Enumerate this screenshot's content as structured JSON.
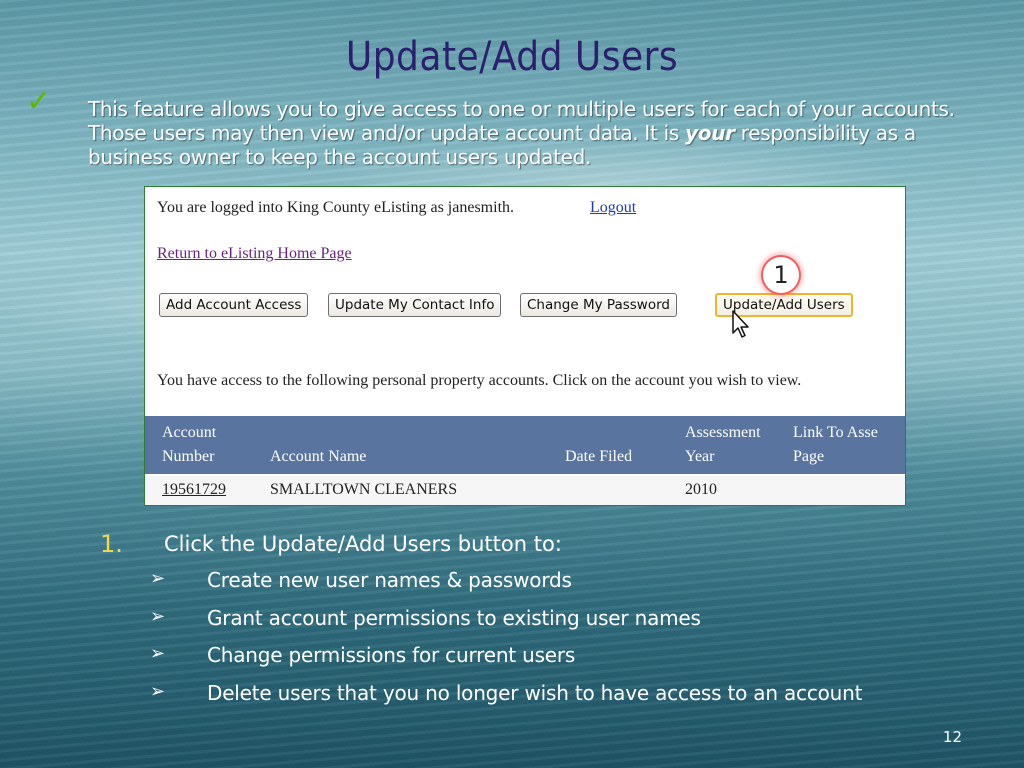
{
  "slide": {
    "title": "Update/Add Users",
    "check_icon": "checkmark-icon",
    "intro_part1": "This feature allows you to give access to one or multiple users for each of your accounts.  Those users may then view and/or update account data.  It is ",
    "intro_emphasis": "your",
    "intro_part2": " responsibility as a business owner to keep the account users updated.",
    "page_number": "12"
  },
  "screenshot": {
    "login_text": "You are logged into King County eListing as janesmith.",
    "logout_label": "Logout",
    "return_link": "Return to eListing Home Page",
    "buttons": {
      "add_account_access": "Add Account Access",
      "update_contact_info": "Update My Contact Info",
      "change_password": "Change My Password",
      "update_add_users": "Update/Add Users"
    },
    "callout_number": "1",
    "access_text": "You have access to the following personal property accounts. Click on the account you wish to view.",
    "table": {
      "headers": {
        "account_number_1": "Account",
        "account_number_2": "Number",
        "account_name": "Account Name",
        "date_filed": "Date Filed",
        "assessment_year_1": "Assessment",
        "assessment_year_2": "Year",
        "link_1": "Link To Asse",
        "link_2": "Page"
      },
      "rows": [
        {
          "account_number": "19561729",
          "account_name": "SMALLTOWN CLEANERS",
          "date_filed": "",
          "assessment_year": "2010"
        }
      ]
    }
  },
  "instructions": {
    "step_number": "1.",
    "step_text": "Click the Update/Add Users button to:",
    "bullet_icon": "arrow-bullet-icon",
    "bullets": [
      "Create new user names & passwords",
      "Grant account permissions to existing user names",
      "Change permissions for current users",
      "Delete users that you no longer wish to have access to an account"
    ]
  },
  "colors": {
    "title": "#2b1f6e",
    "check": "#5fb800",
    "step_number": "#f0d84a",
    "grid_header": "#5a74a0",
    "highlight_border": "#f0b52c"
  }
}
